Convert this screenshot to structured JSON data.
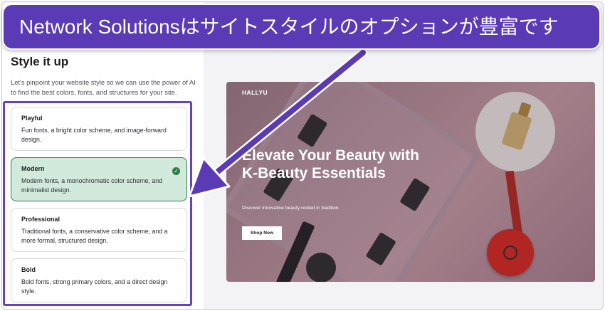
{
  "banner": {
    "text": "Network Solutionsはサイトスタイルのオプションが豊富です"
  },
  "panel": {
    "title": "Style it up",
    "description": "Let's pinpoint your website style so we can use the power of AI to find the best colors, fonts, and structures for your site."
  },
  "options": [
    {
      "title": "Playful",
      "description": "Fun fonts, a bright color scheme, and image-forward design."
    },
    {
      "title": "Modern",
      "description": "Modern fonts, a monochromatic color scheme, and minimalist design."
    },
    {
      "title": "Professional",
      "description": "Traditional fonts, a conservative color scheme, and a more formal, structured design."
    },
    {
      "title": "Bold",
      "description": "Bold fonts, strong primary colors, and a direct design style."
    }
  ],
  "selected_option": "Modern",
  "preview": {
    "brand": "HALLYU",
    "headline": "Elevate Your Beauty with K-Beauty Essentials",
    "subline": "Discover innovative beauty rooted in tradition",
    "button_label": "Shop Now"
  },
  "icons": {
    "selected": "check-circle-icon"
  },
  "colors": {
    "banner": "#5b3ab5",
    "selected_bg": "#d2eadb",
    "selected_border": "#2e7d4b",
    "highlight": "#6a3fc0"
  }
}
